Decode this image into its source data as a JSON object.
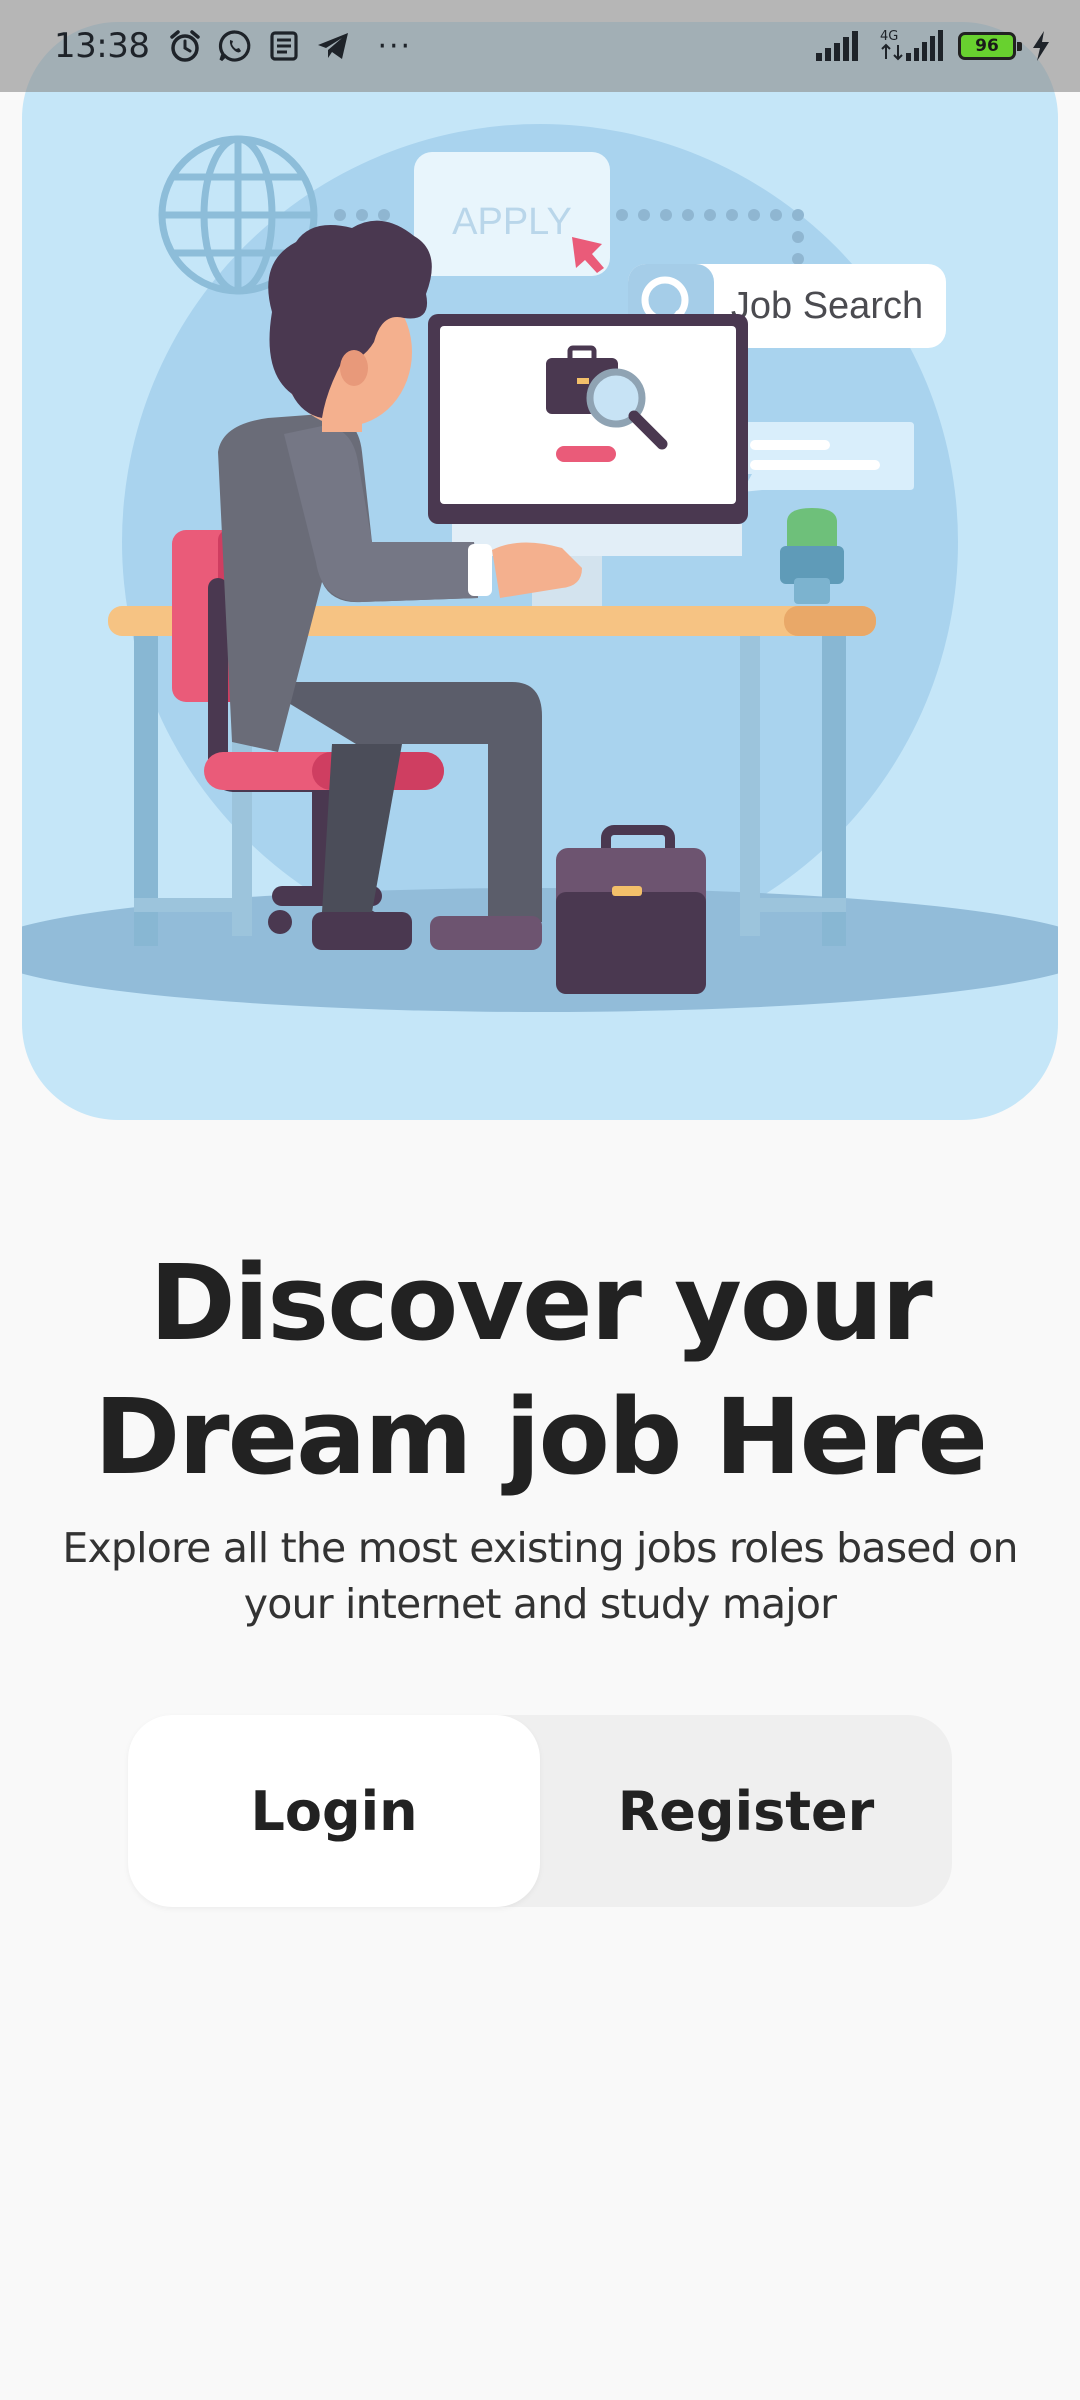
{
  "status_bar": {
    "time": "13:38",
    "network_label": "4G",
    "battery_level": "96",
    "more_indicator": "···",
    "icons": [
      "alarm-icon",
      "whatsapp-icon",
      "news-icon",
      "telegram-icon",
      "signal-icon",
      "signal-4g-icon",
      "battery-icon",
      "charging-icon"
    ]
  },
  "hero": {
    "apply_label": "APPLY",
    "job_search_label": "Job Search"
  },
  "headline": {
    "line1": "Discover your",
    "line2": "Dream job Here"
  },
  "subtitle": {
    "line1": "Explore all the most existing jobs roles based on",
    "line2": "your internet and study major"
  },
  "auth": {
    "login_label": "Login",
    "register_label": "Register"
  },
  "colors": {
    "background": "#f9f9f9",
    "hero_background": "#c5e6f8",
    "text_primary": "#222222",
    "button_active": "#ffffff",
    "button_inactive": "#efefef",
    "battery_fill": "#68d12f"
  }
}
